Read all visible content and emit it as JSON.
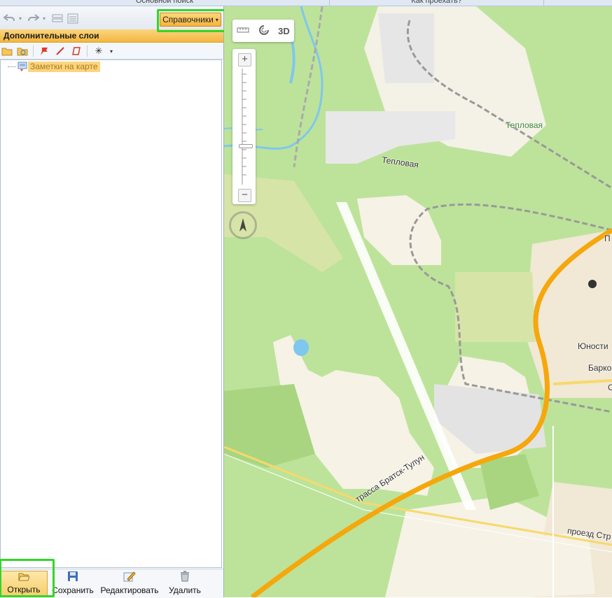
{
  "top_tabs": [
    "Основной поиск",
    "Как проехать?"
  ],
  "toolbar": {
    "dictionaries_label": "Справочники"
  },
  "layers_panel": {
    "title": "Дополнительные слои",
    "items": [
      {
        "label": "Заметки на карте"
      }
    ]
  },
  "bottom_bar": {
    "open": "Открыть",
    "save": "Сохранить",
    "edit": "Редактировать",
    "delete": "Удалить"
  },
  "map": {
    "mode_3d": "3D",
    "labels": {
      "station": "Тепловая",
      "street": "Тепловая",
      "highway": "трасса Братск-Тулун",
      "passage": "проезд Стр",
      "district1": "Юности",
      "district2": "Барко",
      "letter_p": "П",
      "letter_s": "С"
    }
  },
  "colors": {
    "accent": "#f4b740",
    "highlight": "#35d52a",
    "road_main": "#f5a70c",
    "water": "#7fc7ee"
  }
}
